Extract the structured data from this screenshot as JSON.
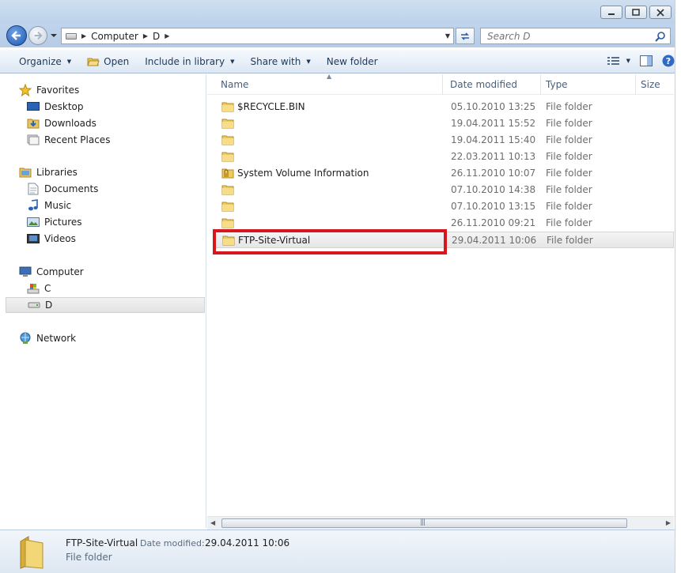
{
  "address": {
    "crumbs": [
      "Computer",
      "D"
    ]
  },
  "search": {
    "placeholder": "Search D"
  },
  "toolbar": {
    "organize": "Organize",
    "open": "Open",
    "include_in_library": "Include in library",
    "share_with": "Share with",
    "new_folder": "New folder"
  },
  "nav": {
    "favorites": {
      "label": "Favorites",
      "items": [
        "Desktop",
        "Downloads",
        "Recent Places"
      ]
    },
    "libraries": {
      "label": "Libraries",
      "items": [
        "Documents",
        "Music",
        "Pictures",
        "Videos"
      ]
    },
    "computer": {
      "label": "Computer",
      "items": [
        "C",
        "D"
      ]
    },
    "network": {
      "label": "Network"
    }
  },
  "columns": {
    "name": "Name",
    "date_modified": "Date modified",
    "type": "Type",
    "size": "Size"
  },
  "files": [
    {
      "name": "$RECYCLE.BIN",
      "date": "05.10.2010 13:25",
      "type": "File folder"
    },
    {
      "name": "",
      "date": "19.04.2011 15:52",
      "type": "File folder"
    },
    {
      "name": "",
      "date": "19.04.2011 15:40",
      "type": "File folder"
    },
    {
      "name": "",
      "date": "22.03.2011 10:13",
      "type": "File folder"
    },
    {
      "name": "System Volume Information",
      "date": "26.11.2010 10:07",
      "type": "File folder"
    },
    {
      "name": "",
      "date": "07.10.2010 14:38",
      "type": "File folder"
    },
    {
      "name": "",
      "date": "07.10.2010 13:15",
      "type": "File folder"
    },
    {
      "name": "",
      "date": "26.11.2010 09:21",
      "type": "File folder"
    },
    {
      "name": "FTP-Site-Virtual",
      "date": "29.04.2011 10:06",
      "type": "File folder"
    }
  ],
  "details": {
    "name": "FTP-Site-Virtual",
    "date_label": "Date modified:",
    "date_value": "29.04.2011 10:06",
    "kind": "File folder"
  }
}
